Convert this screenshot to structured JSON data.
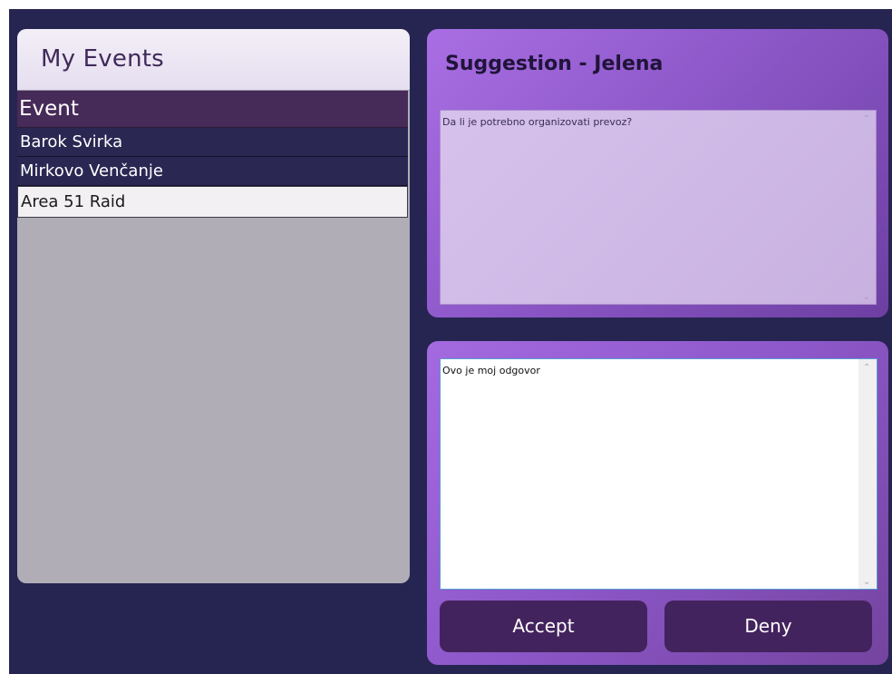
{
  "my_events": {
    "title": "My Events",
    "column_header": "Event",
    "rows": [
      {
        "name": "Barok Svirka"
      },
      {
        "name": "Mirkovo Venčanje"
      },
      {
        "name": "Area 51 Raid"
      }
    ]
  },
  "suggestion": {
    "title": "Suggestion - Jelena",
    "text": "Da li je potrebno organizovati prevoz?"
  },
  "reply": {
    "text": "Ovo je moj odgovor"
  },
  "actions": {
    "accept_label": "Accept",
    "deny_label": "Deny"
  },
  "icons": {
    "scroll_up": "chevron-up-icon",
    "scroll_down": "chevron-down-icon"
  },
  "colors": {
    "background": "#262551",
    "grid_header": "#462a58",
    "button": "#43235d",
    "accent_purple": "#8d58c9"
  }
}
